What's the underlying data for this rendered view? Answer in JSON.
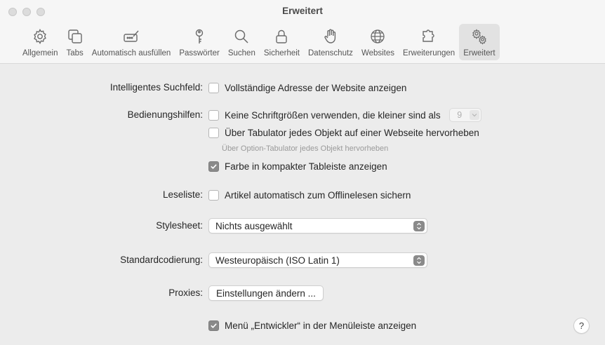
{
  "window": {
    "title": "Erweitert"
  },
  "toolbar": {
    "items": [
      {
        "label": "Allgemein",
        "icon": "gear-icon"
      },
      {
        "label": "Tabs",
        "icon": "tabs-icon"
      },
      {
        "label": "Automatisch ausfüllen",
        "icon": "autofill-icon"
      },
      {
        "label": "Passwörter",
        "icon": "key-icon"
      },
      {
        "label": "Suchen",
        "icon": "search-icon"
      },
      {
        "label": "Sicherheit",
        "icon": "lock-icon"
      },
      {
        "label": "Datenschutz",
        "icon": "hand-icon"
      },
      {
        "label": "Websites",
        "icon": "globe-icon"
      },
      {
        "label": "Erweiterungen",
        "icon": "puzzle-icon"
      },
      {
        "label": "Erweitert",
        "icon": "gears-icon",
        "selected": true
      }
    ]
  },
  "settings": {
    "smart_search": {
      "label": "Intelligentes Suchfeld:",
      "option": "Vollständige Adresse der Website anzeigen",
      "checked": false
    },
    "accessibility": {
      "label": "Bedienungshilfen:",
      "min_font_option": "Keine Schriftgrößen verwenden, die kleiner sind als",
      "min_font_value": "9",
      "min_font_checked": false,
      "tab_option": "Über Tabulator jedes Objekt auf einer Webseite hervorheben",
      "tab_checked": false,
      "tab_hint": "Über Option-Tabulator jedes Objekt hervorheben",
      "compact_option": "Farbe in kompakter Tableiste anzeigen",
      "compact_checked": true
    },
    "reading_list": {
      "label": "Leseliste:",
      "option": "Artikel automatisch zum Offlinelesen sichern",
      "checked": false
    },
    "stylesheet": {
      "label": "Stylesheet:",
      "value": "Nichts ausgewählt"
    },
    "encoding": {
      "label": "Standardcodierung:",
      "value": "Westeuropäisch (ISO Latin 1)"
    },
    "proxies": {
      "label": "Proxies:",
      "button": "Einstellungen ändern ..."
    },
    "developer": {
      "option": "Menü „Entwickler“ in der Menüleiste anzeigen",
      "checked": true
    }
  },
  "help": {
    "label": "?"
  },
  "colors": {
    "background": "#ececec",
    "checkbox_checked": "#8a8a8a",
    "selected_tab": "#e2e2e2"
  }
}
